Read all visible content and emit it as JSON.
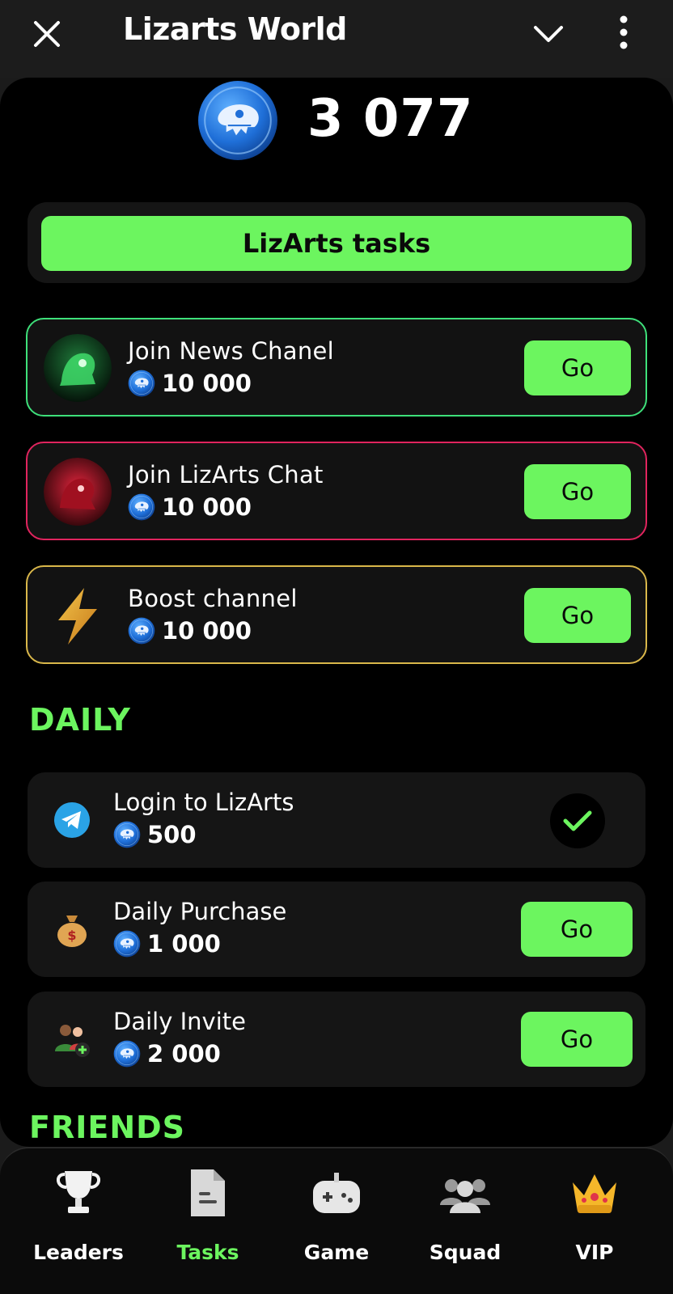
{
  "header": {
    "title": "Lizarts World"
  },
  "balance": {
    "amount": "3 077"
  },
  "tasks_button": {
    "label": "LizArts tasks"
  },
  "tasks": [
    {
      "name": "Join News Chanel",
      "reward": "10 000",
      "button": "Go",
      "border": "#3ee07a"
    },
    {
      "name": "Join LizArts Chat",
      "reward": "10 000",
      "button": "Go",
      "border": "#e0245e"
    },
    {
      "name": "Boost channel",
      "reward": "10 000",
      "button": "Go",
      "border": "#d9b74a"
    }
  ],
  "daily": {
    "title": "DAILY",
    "items": [
      {
        "name": "Login to LizArts",
        "reward": "500",
        "status": "completed",
        "icon": "telegram-icon"
      },
      {
        "name": "Daily Purchase",
        "reward": "1 000",
        "button": "Go",
        "icon": "money-bag-icon"
      },
      {
        "name": "Daily Invite",
        "reward": "2 000",
        "button": "Go",
        "icon": "invite-users-icon"
      }
    ]
  },
  "friends": {
    "title": "FRIENDS"
  },
  "nav": {
    "items": [
      {
        "label": "Leaders",
        "icon": "trophy-icon"
      },
      {
        "label": "Tasks",
        "icon": "document-icon",
        "active": true
      },
      {
        "label": "Game",
        "icon": "gamepad-icon"
      },
      {
        "label": "Squad",
        "icon": "group-icon"
      },
      {
        "label": "VIP",
        "icon": "crown-icon"
      }
    ]
  },
  "colors": {
    "accent": "#6cf55f",
    "background": "#000000",
    "card": "#151515"
  }
}
